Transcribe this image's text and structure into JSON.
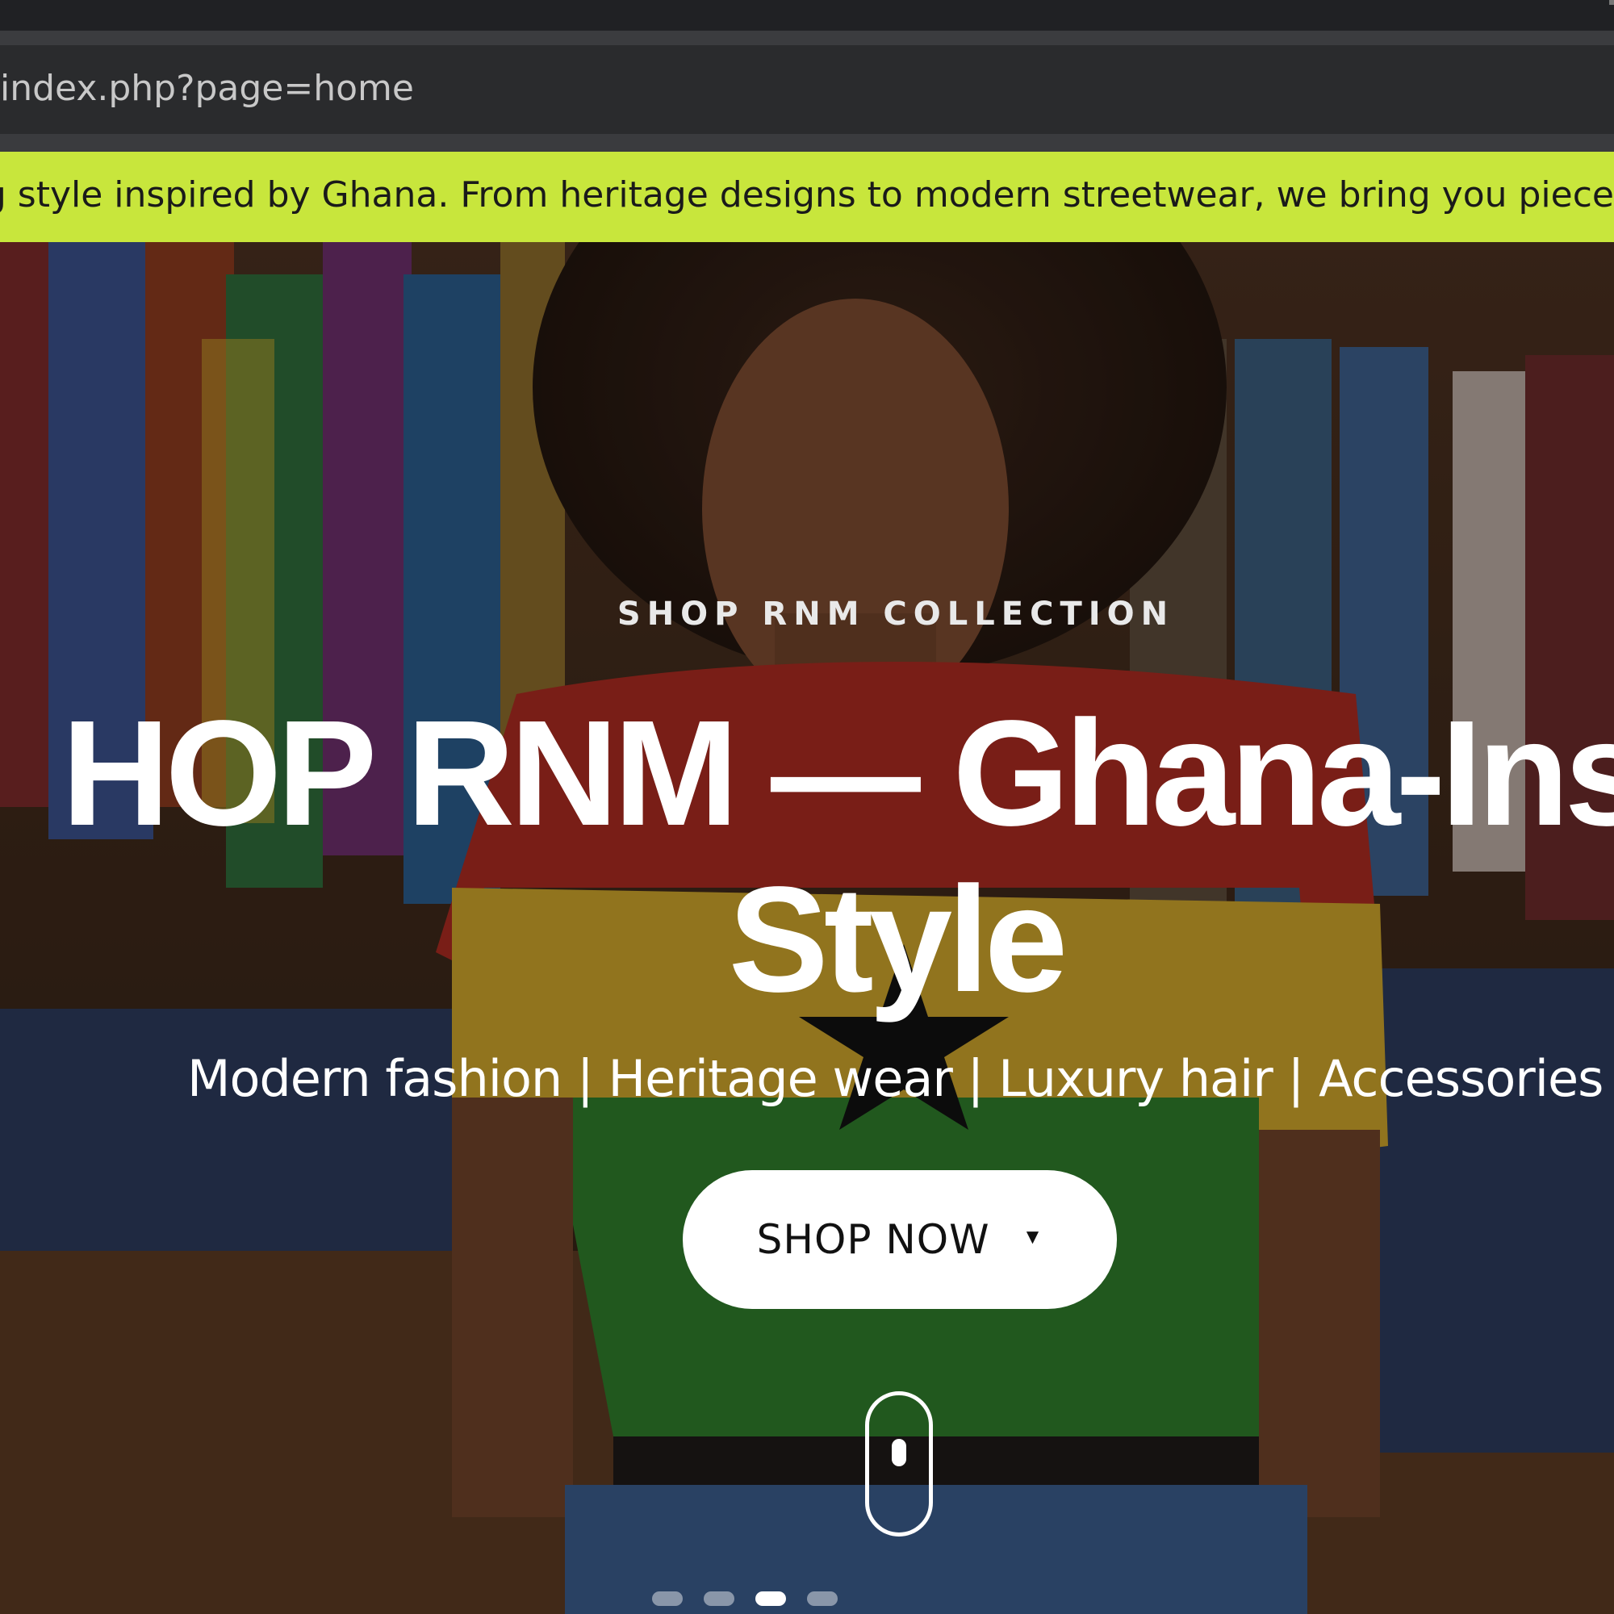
{
  "browser": {
    "url": "index.php?page=home"
  },
  "ticker": {
    "text": "ng style inspired by Ghana. From heritage designs to modern streetwear, we bring you pieces that repr"
  },
  "hero": {
    "eyebrow": "SHOP RNM COLLECTION",
    "headline_line1": "HOP RNM — Ghana-Insp",
    "headline_line2": "Style",
    "subline": "Modern fashion | Heritage wear | Luxury hair | Accessories",
    "cta_label": "SHOP NOW",
    "cta_icon": "caret-down-icon",
    "scroll_icon": "scroll-mouse-icon",
    "slider": {
      "count": 4,
      "active_index": 2
    }
  },
  "colors": {
    "ticker_bg": "#c8e63c",
    "browser_bg": "#202124",
    "cta_bg": "#ffffff",
    "text_light": "#ffffff"
  }
}
